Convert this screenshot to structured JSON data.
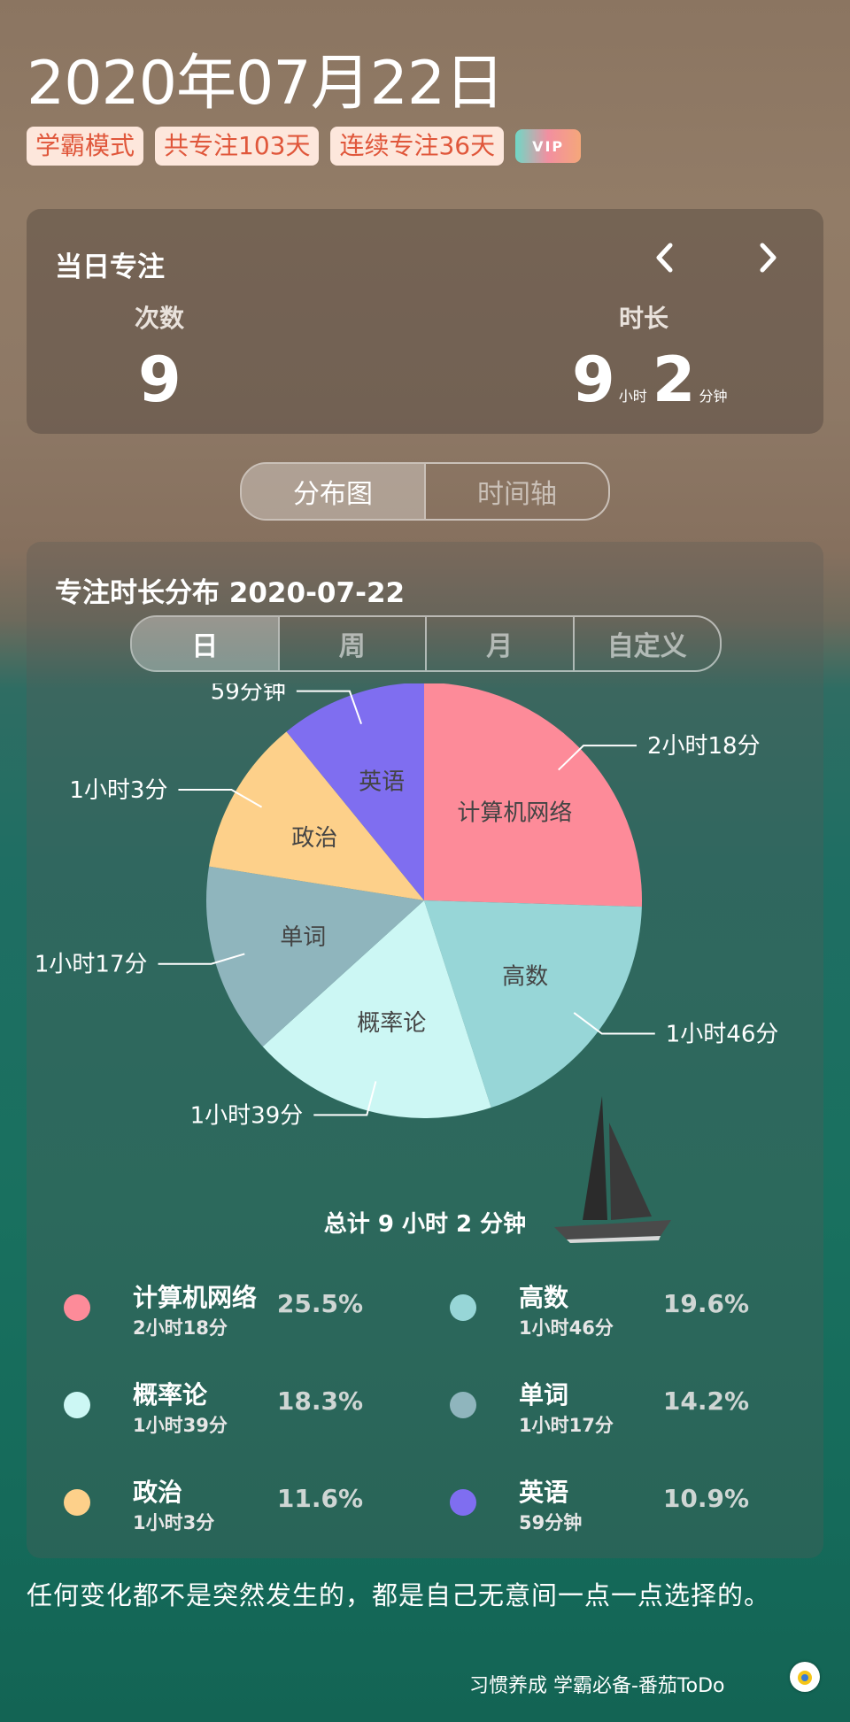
{
  "header": {
    "date": "2020年07月22日",
    "tags": [
      "学霸模式",
      "共专注103天",
      "连续专注36天"
    ],
    "vip_label": "VIP"
  },
  "daily": {
    "title": "当日专注",
    "count_label": "次数",
    "count_value": "9",
    "duration_label": "时长",
    "hours": "9",
    "hours_unit": "小时",
    "minutes": "2",
    "minutes_unit": "分钟"
  },
  "view_tabs": {
    "items": [
      "分布图",
      "时间轴"
    ],
    "active": 0
  },
  "distribution": {
    "title": "专注时长分布  2020-07-22",
    "range_tabs": [
      "日",
      "周",
      "月",
      "自定义"
    ],
    "active_range": 0,
    "total": "总计 9 小时 2 分钟"
  },
  "chart_data": {
    "type": "pie",
    "start_angle_deg": 0,
    "direction": "clockwise",
    "slices": [
      {
        "name": "计算机网络",
        "minutes": 138,
        "time": "2小时18分",
        "percent": "25.5%",
        "color": "#fd8b99"
      },
      {
        "name": "高数",
        "minutes": 106,
        "time": "1小时46分",
        "percent": "19.6%",
        "color": "#97d6d7"
      },
      {
        "name": "概率论",
        "minutes": 99,
        "time": "1小时39分",
        "percent": "18.3%",
        "color": "#ccf7f4"
      },
      {
        "name": "单词",
        "minutes": 77,
        "time": "1小时17分",
        "percent": "14.2%",
        "color": "#8fb5bd"
      },
      {
        "name": "政治",
        "minutes": 63,
        "time": "1小时3分",
        "percent": "11.6%",
        "color": "#fdd08a"
      },
      {
        "name": "英语",
        "minutes": 59,
        "time": "59分钟",
        "percent": "10.9%",
        "color": "#7f6ef0"
      }
    ]
  },
  "quote": "任何变化都不是突然发生的，都是自己无意间一点一点选择的。",
  "footer": "习惯养成 学霸必备-番茄ToDo"
}
